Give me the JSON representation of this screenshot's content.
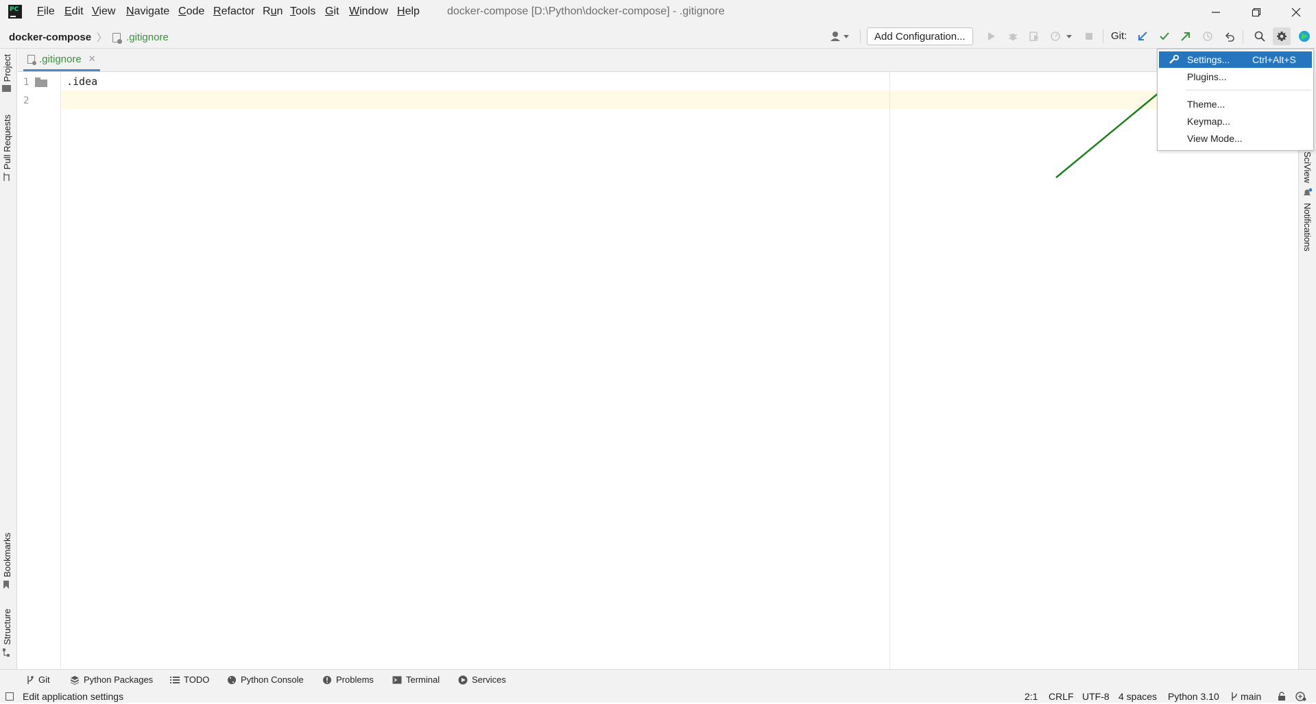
{
  "titlebar": {
    "menus": [
      "File",
      "Edit",
      "View",
      "Navigate",
      "Code",
      "Refactor",
      "Run",
      "Tools",
      "Git",
      "Window",
      "Help"
    ],
    "mnemonics": [
      "F",
      "E",
      "V",
      "N",
      "C",
      "R",
      "u",
      "T",
      "G",
      "W",
      "H"
    ],
    "window_title": "docker-compose [D:\\Python\\docker-compose] - .gitignore"
  },
  "navbar": {
    "project": "docker-compose",
    "file": ".gitignore",
    "add_configuration": "Add Configuration...",
    "git_label": "Git:"
  },
  "left_tabs": {
    "project": "Project",
    "pull_requests": "Pull Requests",
    "bookmarks": "Bookmarks",
    "structure": "Structure"
  },
  "right_tabs": {
    "sciview": "SciView",
    "notifications": "Notifications"
  },
  "editor": {
    "tab_label": ".gitignore",
    "line_numbers": [
      "1",
      "2"
    ],
    "lines": [
      ".idea",
      ""
    ]
  },
  "popup_menu": {
    "settings": "Settings...",
    "settings_shortcut": "Ctrl+Alt+S",
    "plugins": "Plugins...",
    "theme": "Theme...",
    "keymap": "Keymap...",
    "view_mode": "View Mode..."
  },
  "tool_windows": {
    "git": "Git",
    "python_packages": "Python Packages",
    "todo": "TODO",
    "python_console": "Python Console",
    "problems": "Problems",
    "terminal": "Terminal",
    "services": "Services"
  },
  "statusbar": {
    "message": "Edit application settings",
    "position": "2:1",
    "line_ending": "CRLF",
    "encoding": "UTF-8",
    "indent": "4 spaces",
    "interpreter": "Python 3.10",
    "branch": "main"
  },
  "colors": {
    "accent": "#2675bf",
    "git_green": "#3e8f3e",
    "arrow": "#1a7f1a"
  }
}
